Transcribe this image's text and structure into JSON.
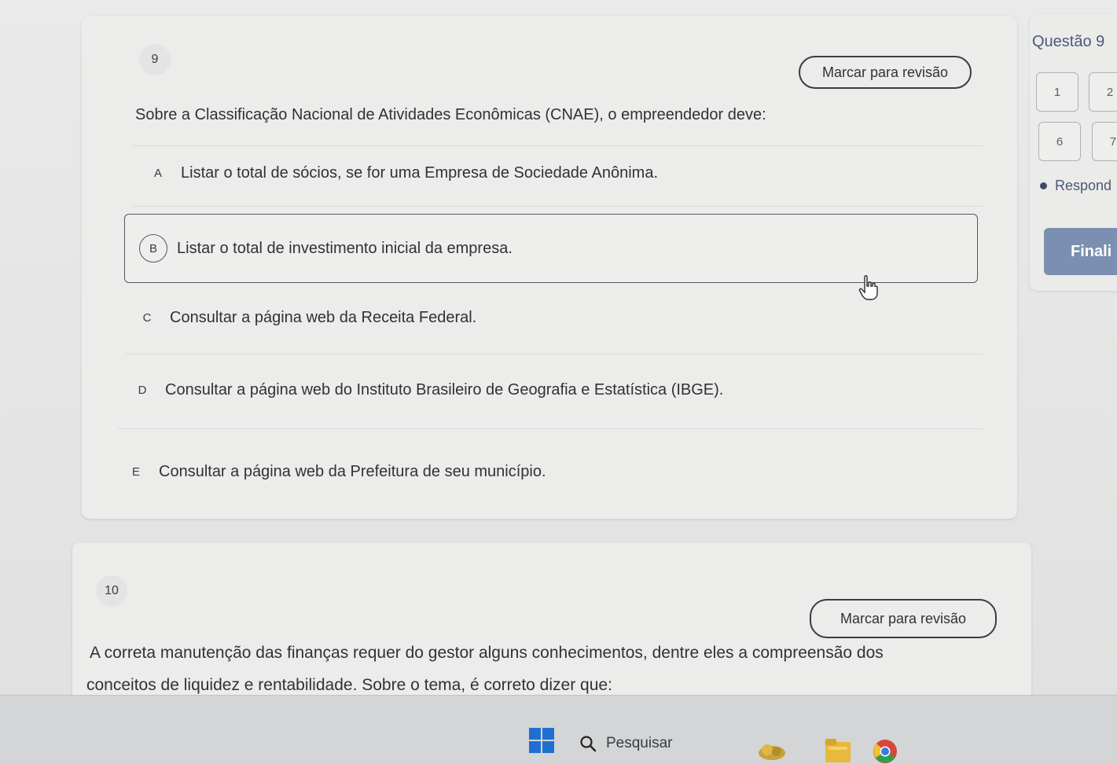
{
  "question9": {
    "number": "9",
    "mark_label": "Marcar para revisão",
    "statement": "Sobre a Classificação Nacional de Atividades Econômicas (CNAE), o empreendedor deve:",
    "alternatives": [
      {
        "letter": "A",
        "text": "Listar o total de sócios, se for uma Empresa de Sociedade Anônima."
      },
      {
        "letter": "B",
        "text": "Listar o total de investimento inicial da empresa.",
        "selected": true
      },
      {
        "letter": "C",
        "text": "Consultar a página web da Receita Federal."
      },
      {
        "letter": "D",
        "text": "Consultar a página web do Instituto Brasileiro de Geografia e Estatística (IBGE)."
      },
      {
        "letter": "E",
        "text": "Consultar a página web da Prefeitura de seu município."
      }
    ]
  },
  "question10": {
    "number": "10",
    "mark_label": "Marcar para revisão",
    "statement_line1": "A correta manutenção das finanças requer do gestor alguns conhecimentos, dentre eles a compreensão dos",
    "statement_line2": "conceitos de liquidez e rentabilidade. Sobre o tema, é correto dizer que:"
  },
  "side_panel": {
    "title": "Questão 9",
    "nav_numbers": [
      "1",
      "2",
      "6",
      "7"
    ],
    "legend_label": "Respond",
    "finish_label": "Finali"
  },
  "taskbar": {
    "search_placeholder": "Pesquisar",
    "icons": [
      "windows-start-icon",
      "search-icon",
      "weather-icon",
      "file-explorer-icon",
      "chrome-icon"
    ]
  },
  "colors": {
    "accent": "#7b8fb0",
    "title_blue": "#4a5a78",
    "windows_blue": "#1f6fd0"
  }
}
